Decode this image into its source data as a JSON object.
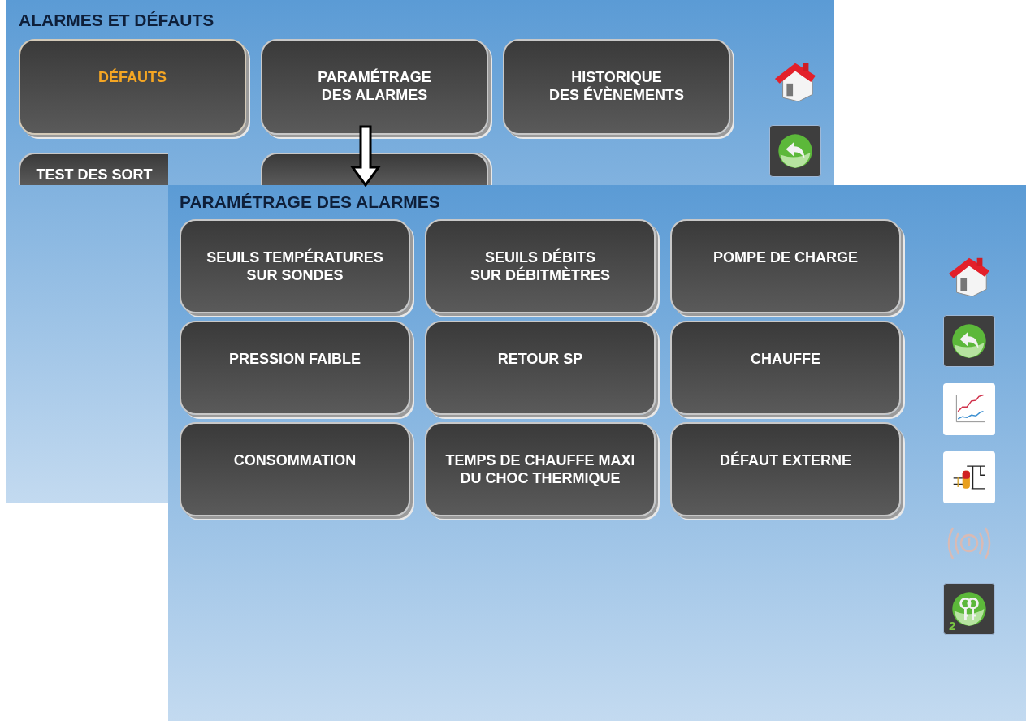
{
  "screens": [
    {
      "title": "ALARMES ET DÉFAUTS",
      "buttons": [
        {
          "label": "DÉFAUTS",
          "selected": true,
          "covered": false
        },
        {
          "label": "PARAMÉTRAGE\nDES ALARMES",
          "selected": false,
          "covered": false
        },
        {
          "label": "HISTORIQUE\nDES ÉVÈNEMENTS",
          "selected": false,
          "covered": false
        },
        {
          "label": "TEST DES SORT",
          "selected": false,
          "covered": true
        },
        {
          "selected": false,
          "covered": true
        }
      ],
      "sidebar": [
        {
          "kind": "home",
          "disabled": false
        },
        {
          "kind": "back",
          "disabled": false
        }
      ]
    },
    {
      "title": "PARAMÉTRAGE DES ALARMES",
      "buttons": [
        {
          "label": "SEUILS TEMPÉRATURES\nSUR SONDES",
          "selected": false,
          "covered": false
        },
        {
          "label": "SEUILS DÉBITS\nSUR DÉBITMÈTRES",
          "selected": false,
          "covered": false
        },
        {
          "label": "POMPE DE CHARGE",
          "selected": false,
          "covered": false
        },
        {
          "label": "PRESSION FAIBLE",
          "selected": false,
          "covered": false
        },
        {
          "label": "RETOUR SP",
          "selected": false,
          "covered": false
        },
        {
          "label": "CHAUFFE",
          "selected": false,
          "covered": false
        },
        {
          "label": "CONSOMMATION",
          "selected": false,
          "covered": false
        },
        {
          "label": "TEMPS DE CHAUFFE MAXI\nDU CHOC THERMIQUE",
          "selected": false,
          "covered": false
        },
        {
          "label": "DÉFAUT EXTERNE",
          "selected": false,
          "covered": false
        }
      ],
      "sidebar": [
        {
          "kind": "home",
          "disabled": false
        },
        {
          "kind": "back",
          "disabled": false
        },
        {
          "kind": "chart",
          "disabled": false
        },
        {
          "kind": "schematic",
          "disabled": false
        },
        {
          "kind": "alarm",
          "disabled": true
        },
        {
          "kind": "keys",
          "disabled": false,
          "badge": "2"
        }
      ]
    }
  ]
}
